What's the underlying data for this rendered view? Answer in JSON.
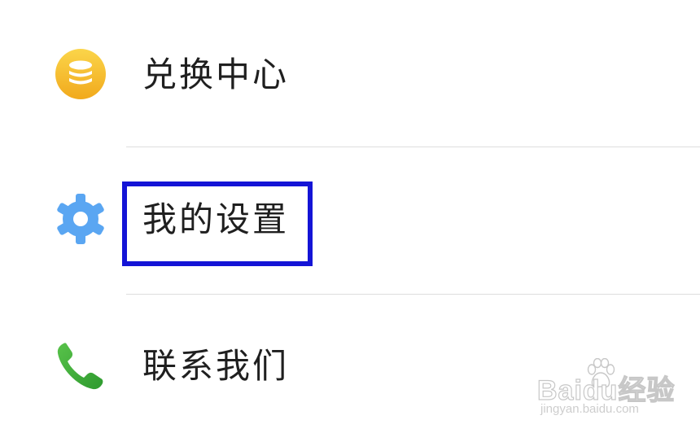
{
  "menu": {
    "items": [
      {
        "label": "兑换中心",
        "icon": "coins-icon"
      },
      {
        "label": "我的设置",
        "icon": "gear-icon"
      },
      {
        "label": "联系我们",
        "icon": "phone-icon"
      }
    ]
  },
  "colors": {
    "coins_icon": "#f5c02e",
    "gear_icon": "#5aa6f2",
    "phone_icon": "#3fae3a",
    "highlight_box": "#1414d6",
    "divider": "#dedede",
    "text": "#1f1f1f"
  },
  "highlight": {
    "target": "我的设置"
  },
  "watermark": {
    "brand": "Baidu经验",
    "url": "jingyan.baidu.com"
  }
}
